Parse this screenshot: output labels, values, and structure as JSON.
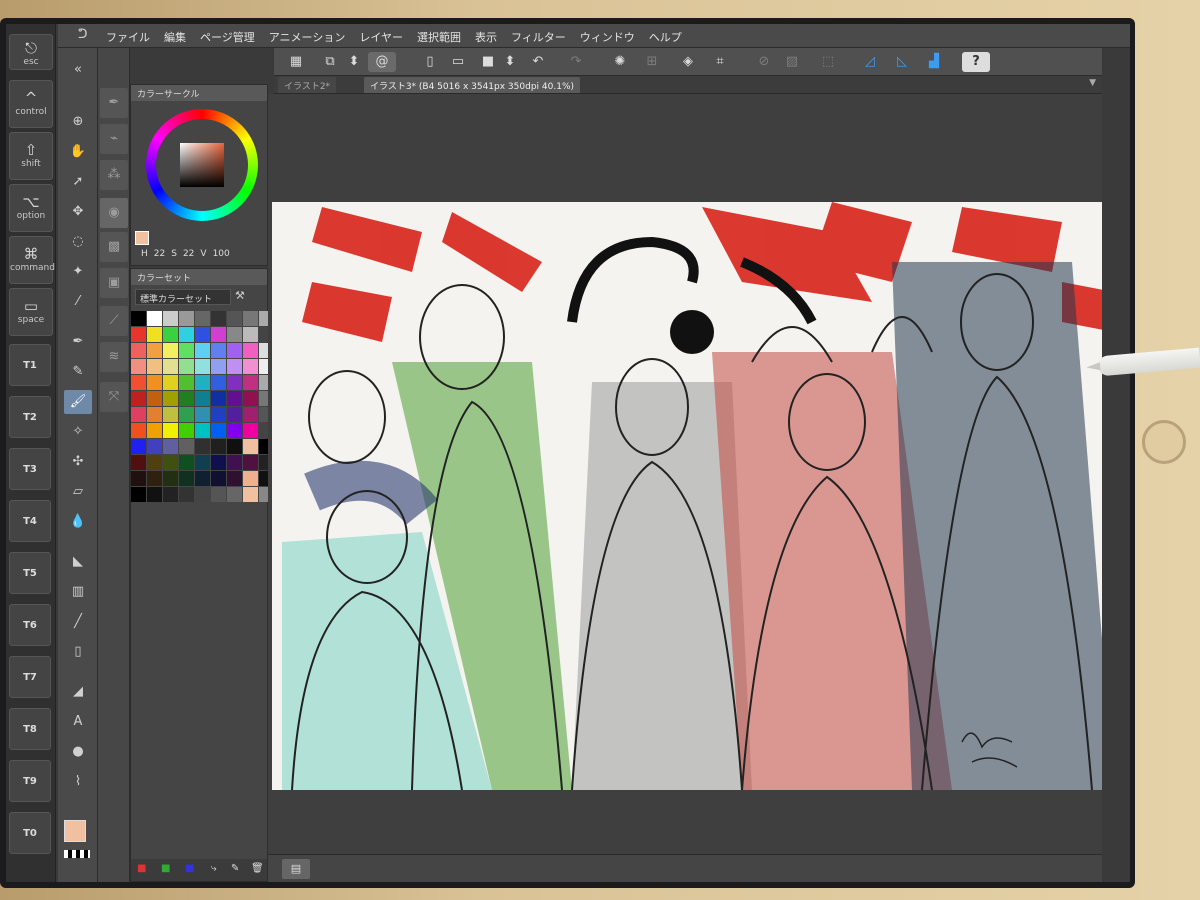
{
  "modifier_keys": [
    {
      "glyph": "⎋",
      "label": "esc"
    },
    {
      "glyph": "^",
      "label": "control"
    },
    {
      "glyph": "⇧",
      "label": "shift"
    },
    {
      "glyph": "⌥",
      "label": "option"
    },
    {
      "glyph": "⌘",
      "label": "command"
    },
    {
      "glyph": "▭",
      "label": "space"
    }
  ],
  "tool_keys": [
    "T1",
    "T2",
    "T3",
    "T4",
    "T5",
    "T6",
    "T7",
    "T8",
    "T9",
    "T0"
  ],
  "menu": {
    "items": [
      "ファイル",
      "編集",
      "ページ管理",
      "アニメーション",
      "レイヤー",
      "選択範囲",
      "表示",
      "フィルター",
      "ウィンドウ",
      "ヘルプ"
    ]
  },
  "tabs": [
    {
      "label": "イラスト2*",
      "active": false
    },
    {
      "label": "イラスト3* (B4 5016 x 3541px 350dpi 40.1%)",
      "active": true
    }
  ],
  "color_panel": {
    "title": "カラーサークル",
    "h_label": "H",
    "h_value": "22",
    "s_label": "S",
    "s_value": "22",
    "v_label": "V",
    "v_value": "100",
    "current_color": "#f0c0a0"
  },
  "color_set_panel": {
    "title": "カラーセット",
    "selected_set": "標準カラーセット"
  },
  "colors": {
    "panel_bg": "#454545",
    "accent_blue": "#3d9cf0",
    "red_paint": "#d8231b"
  }
}
